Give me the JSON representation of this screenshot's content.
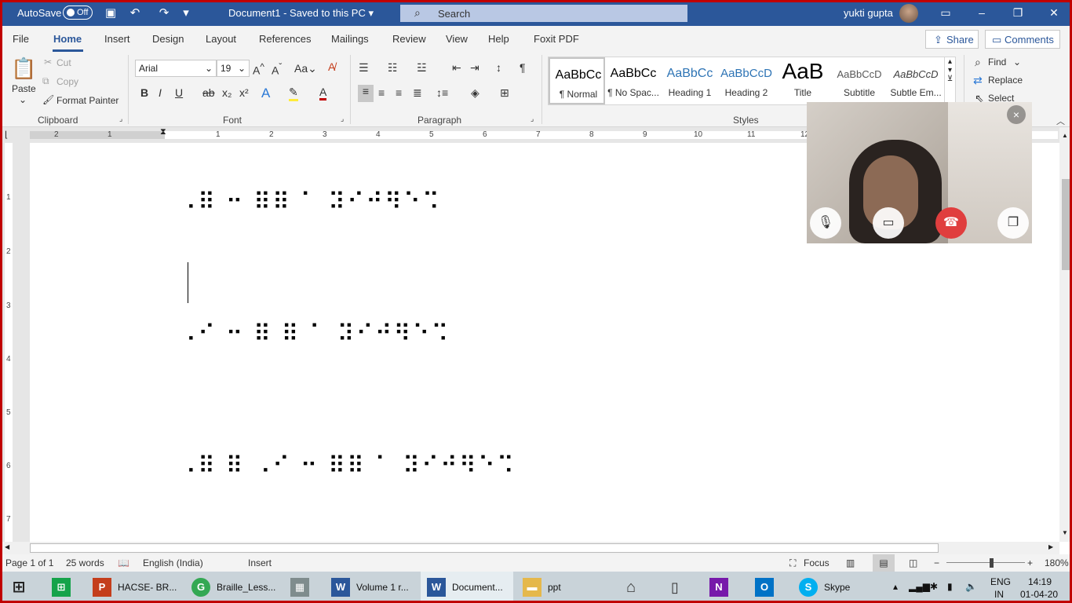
{
  "titlebar": {
    "autosave_label": "AutoSave",
    "autosave_state": "Off",
    "document": "Document1  -  Saved to this PC  ▾",
    "search_placeholder": "Search",
    "user": "yukti gupta",
    "icons": [
      "save-icon",
      "undo-icon",
      "redo-icon",
      "customize-icon",
      "ribbon-display-icon",
      "minimize-icon",
      "restore-icon",
      "close-icon"
    ]
  },
  "ribbon_tabs": [
    "File",
    "Home",
    "Insert",
    "Design",
    "Layout",
    "References",
    "Mailings",
    "Review",
    "View",
    "Help",
    "Foxit PDF"
  ],
  "ribbon_actions": {
    "share": "Share",
    "comments": "Comments"
  },
  "clipboard": {
    "paste": "Paste",
    "cut": "Cut",
    "copy": "Copy",
    "format_painter": "Format Painter",
    "label": "Clipboard"
  },
  "font": {
    "name": "Arial",
    "size": "19",
    "label": "Font"
  },
  "paragraph": {
    "label": "Paragraph"
  },
  "styles": {
    "label": "Styles",
    "items": [
      {
        "preview": "AaBbCc",
        "name": "¶ Normal"
      },
      {
        "preview": "AaBbCc",
        "name": "¶ No Spac..."
      },
      {
        "preview": "AaBbCc",
        "name": "Heading 1"
      },
      {
        "preview": "AaBbCcD",
        "name": "Heading 2"
      },
      {
        "preview": "AaB",
        "name": "Title"
      },
      {
        "preview": "AaBbCcD",
        "name": "Subtitle"
      },
      {
        "preview": "AaBbCcD",
        "name": "Subtle Em..."
      }
    ]
  },
  "editing": {
    "find": "Find",
    "replace": "Replace",
    "select": "Select"
  },
  "ruler_numbers": [
    "2",
    "1",
    "1",
    "2",
    "3",
    "4",
    "5",
    "6",
    "7",
    "8",
    "9",
    "10",
    "11",
    "12"
  ],
  "vruler_numbers": [
    "1",
    "2",
    "3",
    "4",
    "5",
    "6",
    "7"
  ],
  "document_lines": [
    "⠠⠿ ⠒ ⠿⠿ ⠁ ⠽⠊⠚⠻⠑⠩",
    "⠠⠊ ⠒ ⠿ ⠿ ⠁ ⠽⠊⠚⠻⠑⠩",
    "⠠⠿ ⠿ ⠠⠊ ⠒ ⠿⠿ ⠁ ⠽⠊⠚⠻⠑⠩"
  ],
  "statusbar": {
    "page": "Page 1 of 1",
    "words": "25 words",
    "language": "English (India)",
    "mode": "Insert",
    "focus": "Focus",
    "zoom": "180%"
  },
  "skype_call": {
    "close": "×"
  },
  "taskbar": {
    "apps": [
      {
        "label": "HACSE- BR...",
        "color": "#c43e1c",
        "glyph": "P"
      },
      {
        "label": "Braille_Less...",
        "color": "#34a853",
        "glyph": "G"
      },
      {
        "label": "",
        "color": "#7f8c8d",
        "glyph": "▦"
      },
      {
        "label": "Volume 1 r...",
        "color": "#2b579a",
        "glyph": "W"
      },
      {
        "label": "Document...",
        "color": "#2b579a",
        "glyph": "W"
      },
      {
        "label": "ppt",
        "color": "#e5b84b",
        "glyph": "▬"
      },
      {
        "label": "Skype",
        "color": "#00aff0",
        "glyph": "S"
      }
    ],
    "lang": "ENG",
    "region": "IN",
    "time": "14:19",
    "date": "01-04-20"
  }
}
